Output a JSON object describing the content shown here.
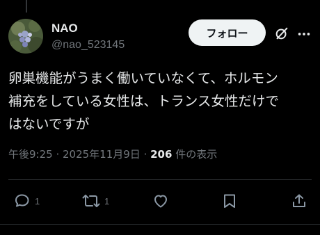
{
  "author": {
    "name": "NAO",
    "handle": "@nao_523145",
    "avatar_icon": "avatar-photo-icon"
  },
  "header": {
    "follow_label": "フォロー",
    "grok_icon": "grok-icon",
    "more_icon": "more-icon"
  },
  "tweet": {
    "text": "卵巣機能がうまく働いていなくて、ホルモン\n補充をしている女性は、トランス女性だけで\nはないですが"
  },
  "meta": {
    "time": "午後9:25",
    "sep1": " · ",
    "date": "2025年11月9日",
    "sep2": " · ",
    "views_count": "206",
    "views_label": " 件の表示"
  },
  "actions": {
    "reply_count": "1",
    "repost_count": "1"
  },
  "colors": {
    "background": "#000000",
    "text": "#e7e9ea",
    "secondary": "#71767b",
    "follow_bg": "#eff3f4"
  }
}
